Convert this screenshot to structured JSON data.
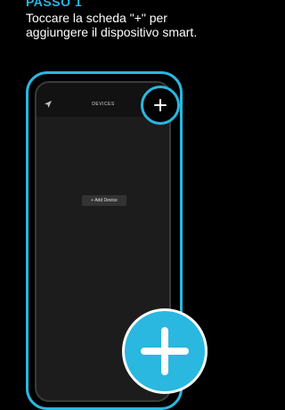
{
  "instructions": {
    "step_label": "PASSO 1",
    "text": "Toccare la scheda \"+\" per aggiungere il dispositivo smart."
  },
  "app": {
    "header_title": "DEVICES",
    "add_device_label": "+ Add Device"
  },
  "icons": {
    "nav": "navigation-arrow-icon",
    "add": "plus-icon",
    "big_add": "plus-icon"
  },
  "colors": {
    "accent": "#2ab7e0",
    "background": "#000000",
    "screen": "#1c1c1c"
  }
}
